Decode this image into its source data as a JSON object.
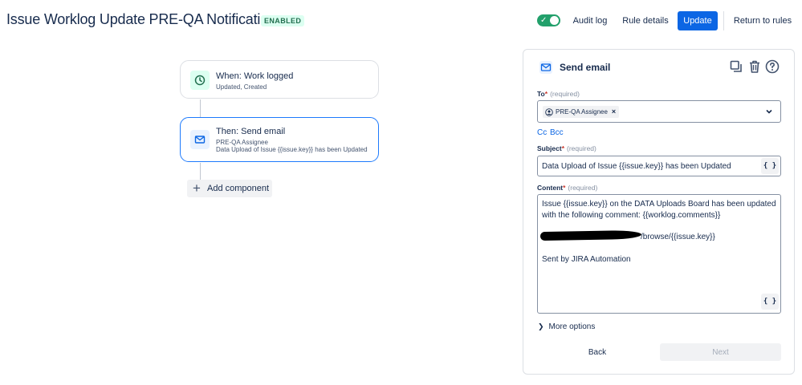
{
  "header": {
    "title": "Issue Worklog Update PRE-QA Notification",
    "status_badge": "ENABLED",
    "toggle_checked": true,
    "audit_log_label": "Audit log",
    "rule_details_label": "Rule details",
    "update_label": "Update",
    "return_label": "Return to rules"
  },
  "flow": {
    "trigger": {
      "title": "When: Work logged",
      "subtitle": "Updated, Created",
      "icon": "clock-icon"
    },
    "action": {
      "title": "Then: Send email",
      "line1": "PRE-QA Assignee",
      "line2": "Data Upload of Issue {{issue.key}} has been Updated",
      "icon": "mail-icon"
    },
    "add_component_label": "Add component"
  },
  "panel": {
    "title": "Send email",
    "to": {
      "label": "To",
      "required_text": "(required)",
      "chip_label": "PRE-QA Assignee"
    },
    "cc_label": "Cc",
    "bcc_label": "Bcc",
    "subject": {
      "label": "Subject",
      "required_text": "(required)",
      "value": "Data Upload of Issue {{issue.key}} has been Updated"
    },
    "content": {
      "label": "Content",
      "required_text": "(required)",
      "line1": "Issue {{issue.key}} on the DATA Uploads Board has been updated",
      "line2": "with the following comment: {{worklog.comments}}",
      "line3_suffix": "/browse/{{issue.key}}",
      "line4": "Sent by JIRA Automation"
    },
    "smart_value_label": "{ }",
    "more_options_label": "More options",
    "back_label": "Back",
    "next_label": "Next"
  },
  "colors": {
    "primary": "#0c66e4",
    "success": "#22a06b",
    "selected_border": "#1d7afc"
  }
}
